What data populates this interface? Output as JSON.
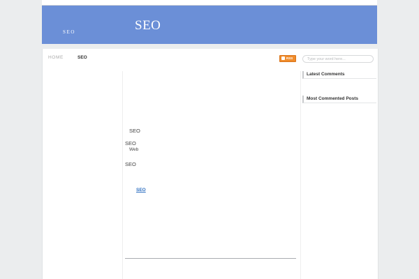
{
  "header": {
    "site_title": "SEO",
    "tagline": "SEO"
  },
  "nav": {
    "items": [
      {
        "label": "HOME"
      },
      {
        "label": "SEO"
      }
    ]
  },
  "rss": {
    "label": "RSS"
  },
  "search": {
    "placeholder": "Type your word here..."
  },
  "main": {
    "lines": [
      "SEO",
      "SEO",
      "Web",
      "SEO"
    ],
    "link_label": "SEO"
  },
  "sidebar": {
    "widgets": [
      {
        "title": "Latest Comments"
      },
      {
        "title": "Most Commented Posts"
      }
    ]
  }
}
